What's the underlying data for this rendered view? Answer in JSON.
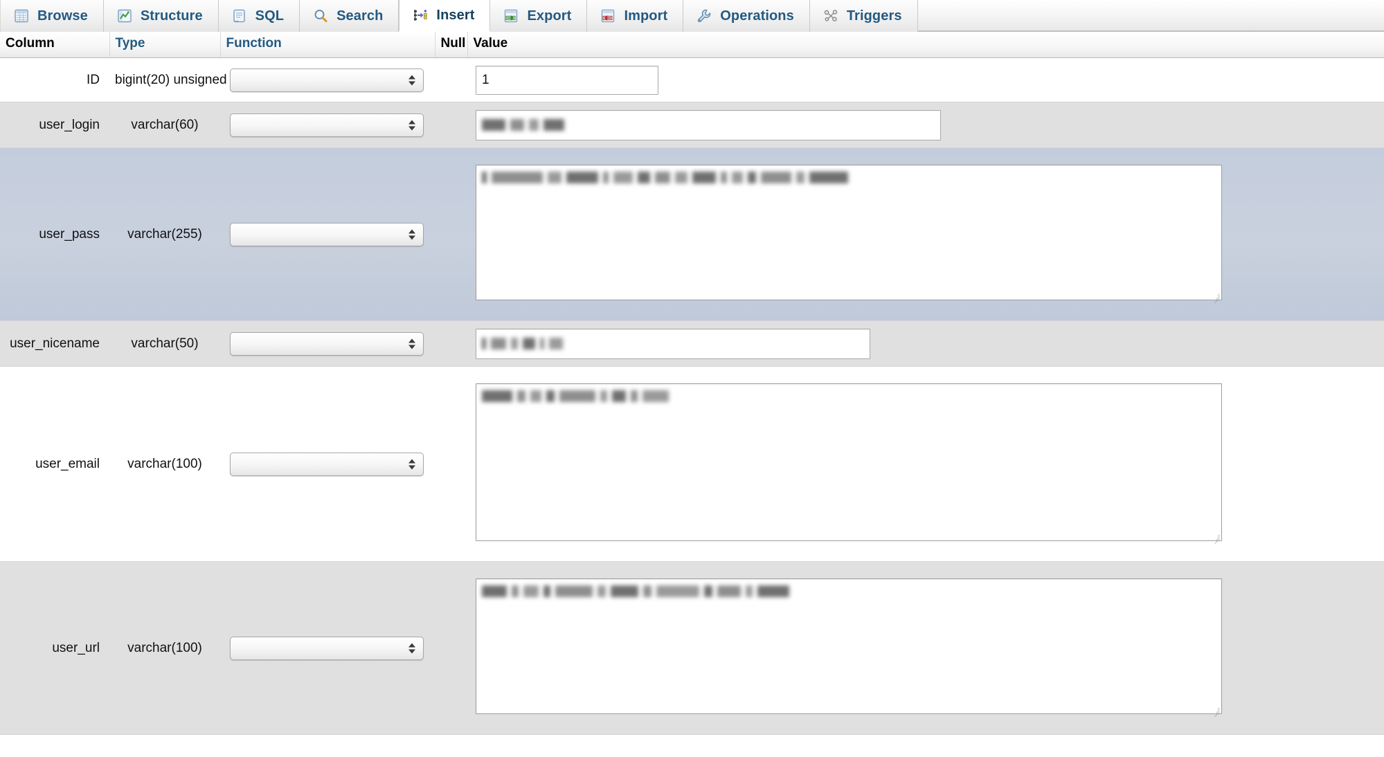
{
  "tabs": [
    {
      "label": "Browse",
      "icon": "browse-table-icon",
      "active": false
    },
    {
      "label": "Structure",
      "icon": "structure-icon",
      "active": false
    },
    {
      "label": "SQL",
      "icon": "sql-scroll-icon",
      "active": false
    },
    {
      "label": "Search",
      "icon": "search-magnifier-icon",
      "active": false
    },
    {
      "label": "Insert",
      "icon": "insert-row-icon",
      "active": true
    },
    {
      "label": "Export",
      "icon": "export-icon",
      "active": false
    },
    {
      "label": "Import",
      "icon": "import-icon",
      "active": false
    },
    {
      "label": "Operations",
      "icon": "wrench-icon",
      "active": false
    },
    {
      "label": "Triggers",
      "icon": "triggers-icon",
      "active": false
    }
  ],
  "table": {
    "headers": {
      "column": "Column",
      "type": "Type",
      "function": "Function",
      "null": "Null",
      "value": "Value"
    },
    "rows": [
      {
        "column": "ID",
        "type": "bigint(20) unsigned",
        "function_selected": "",
        "null_checked": false,
        "value": "1",
        "value_redacted": false,
        "input_kind": "text",
        "row_style": "odd",
        "selected": false
      },
      {
        "column": "user_login",
        "type": "varchar(60)",
        "function_selected": "",
        "null_checked": false,
        "value": "",
        "value_redacted": true,
        "input_kind": "text",
        "row_style": "even",
        "selected": false
      },
      {
        "column": "user_pass",
        "type": "varchar(255)",
        "function_selected": "",
        "null_checked": false,
        "value": "",
        "value_redacted": true,
        "input_kind": "textarea",
        "row_style": "odd",
        "selected": true
      },
      {
        "column": "user_nicename",
        "type": "varchar(50)",
        "function_selected": "",
        "null_checked": false,
        "value": "",
        "value_redacted": true,
        "input_kind": "text",
        "row_style": "even",
        "selected": false
      },
      {
        "column": "user_email",
        "type": "varchar(100)",
        "function_selected": "",
        "null_checked": false,
        "value": "",
        "value_redacted": true,
        "input_kind": "textarea",
        "row_style": "odd",
        "selected": false
      },
      {
        "column": "user_url",
        "type": "varchar(100)",
        "function_selected": "",
        "null_checked": false,
        "value": "",
        "value_redacted": true,
        "input_kind": "textarea",
        "row_style": "even",
        "selected": false
      }
    ]
  },
  "colors": {
    "tab_label": "#235a81",
    "header_blue": "#235a81",
    "header_black": "#000000",
    "row_even": "#e0e0e0",
    "row_odd": "#ffffff",
    "row_selected": "#c5cedd",
    "tabbar_bg": "#eeeeee"
  }
}
